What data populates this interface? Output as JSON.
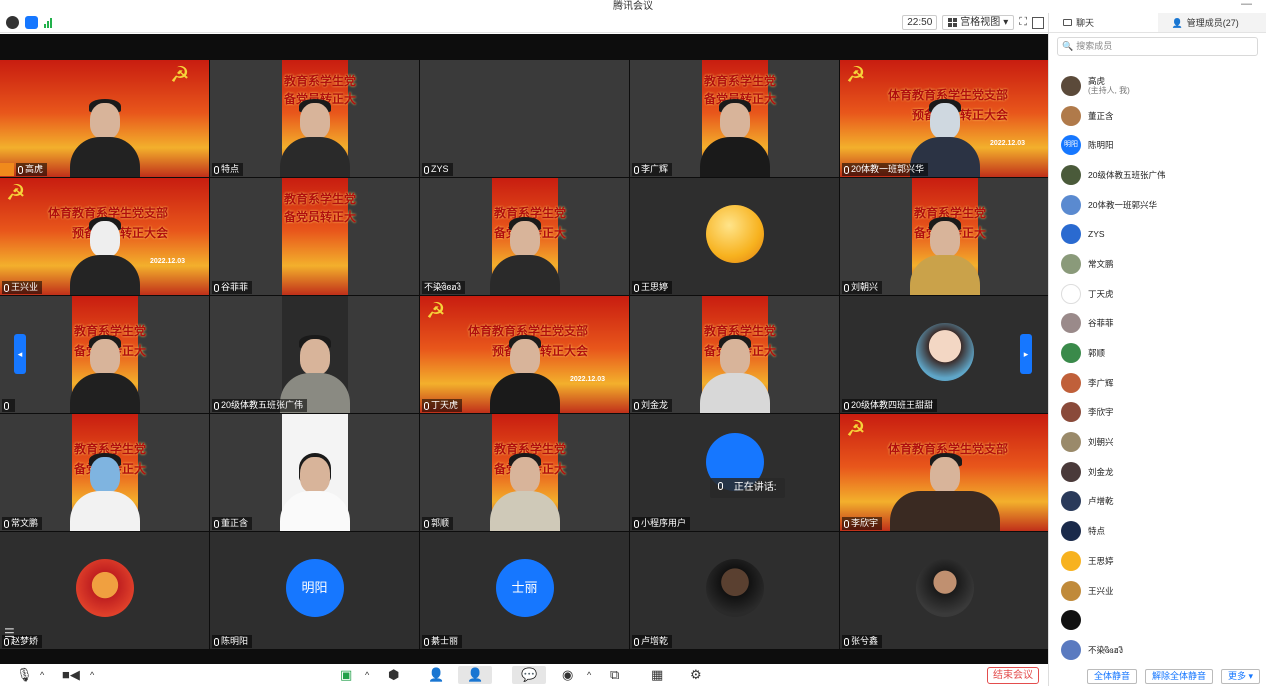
{
  "window": {
    "title": "腾讯会议",
    "minimize": "—"
  },
  "toolbar": {
    "time": "22:50",
    "view_label": "宫格视图",
    "view_arrow": "▾"
  },
  "panel": {
    "tab_chat": "聊天",
    "tab_members": "管理成员(27)",
    "search_placeholder": "搜索成员",
    "members": [
      {
        "name": "高虎",
        "sub": "(主持人, 我)",
        "color": "#5b4a3a"
      },
      {
        "name": "董正含",
        "sub": "",
        "color": "#b07a4a"
      },
      {
        "name": "陈明阳",
        "sub": "",
        "color": "#1677ff",
        "initials": "明阳"
      },
      {
        "name": "20级体教五班张广伟",
        "sub": "",
        "color": "#4a5a3a"
      },
      {
        "name": "20体教一班郭兴华",
        "sub": "",
        "color": "#5a8ad0"
      },
      {
        "name": "ZYS",
        "sub": "",
        "color": "#2a6ad0"
      },
      {
        "name": "常文鹏",
        "sub": "",
        "color": "#8a9a7a"
      },
      {
        "name": "丁天虎",
        "sub": "",
        "color": "#ffffff"
      },
      {
        "name": "谷菲菲",
        "sub": "",
        "color": "#9a8a8a"
      },
      {
        "name": "郭顺",
        "sub": "",
        "color": "#3a8a4a"
      },
      {
        "name": "李广辉",
        "sub": "",
        "color": "#c0603a"
      },
      {
        "name": "李欣宇",
        "sub": "",
        "color": "#8a4a3a"
      },
      {
        "name": "刘朝兴",
        "sub": "",
        "color": "#9a8a6a"
      },
      {
        "name": "刘金龙",
        "sub": "",
        "color": "#4a3a3a"
      },
      {
        "name": "卢增乾",
        "sub": "",
        "color": "#2a3a5a"
      },
      {
        "name": "特点",
        "sub": "",
        "color": "#1a2a4a"
      },
      {
        "name": "王思婷",
        "sub": "",
        "color": "#f7b21f"
      },
      {
        "name": "王兴业",
        "sub": "",
        "color": "#c08a3a"
      },
      {
        "name": "",
        "sub": "",
        "color": "#111111"
      },
      {
        "name": "不染ɞิɞฮงิ",
        "sub": "",
        "color": "#5a7ac0"
      }
    ],
    "footer": {
      "mute_all": "全体静音",
      "unmute_all": "解除全体静音",
      "more": "更多 ▾"
    }
  },
  "tiles": [
    {
      "name": "高虎",
      "host": true
    },
    {
      "name": "特点"
    },
    {
      "name": "ZYS"
    },
    {
      "name": "李广辉"
    },
    {
      "name": "20体教一班郭兴华"
    },
    {
      "name": "王兴业"
    },
    {
      "name": "谷菲菲"
    },
    {
      "name": "不染ɞิɞฮงิ"
    },
    {
      "name": "王思婷"
    },
    {
      "name": "刘朝兴"
    },
    {
      "name": ""
    },
    {
      "name": "20级体教五班张广伟"
    },
    {
      "name": "丁天虎"
    },
    {
      "name": "刘金龙"
    },
    {
      "name": "20级体教四班王甜甜"
    },
    {
      "name": "常文鹏"
    },
    {
      "name": "董正含"
    },
    {
      "name": "郭顺"
    },
    {
      "name": "小程序用户"
    },
    {
      "name": "李欣宇"
    },
    {
      "name": "赵梦娇"
    },
    {
      "name": "陈明阳",
      "initials": "明阳"
    },
    {
      "name": "綦士丽",
      "initials": "士丽"
    },
    {
      "name": "卢增乾"
    },
    {
      "name": "张兮鑫"
    }
  ],
  "banner": {
    "line1": "体育教育系学生党支部",
    "line2": "预备党员转正大会",
    "line1_short": "教育系学生党",
    "line2_short": "备党员转正大",
    "line1_short2": "教育系学生党",
    "line2_short2": "备党员转正大",
    "date": "2022.12.03"
  },
  "speaking_label": "正在讲话:",
  "end_meeting": "结束会议"
}
